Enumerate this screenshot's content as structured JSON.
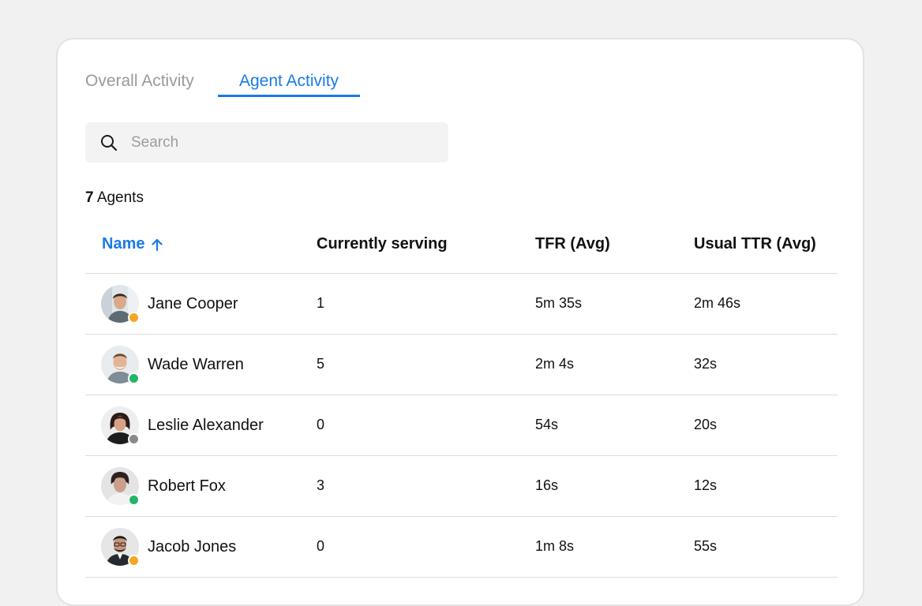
{
  "tabs": [
    {
      "label": "Overall Activity",
      "active": false
    },
    {
      "label": "Agent Activity",
      "active": true
    }
  ],
  "search": {
    "placeholder": "Search",
    "icon": "search-icon"
  },
  "agents_count": {
    "number": "7",
    "label": "Agents"
  },
  "table": {
    "headers": {
      "name": "Name",
      "sort_icon": "arrow-up-icon",
      "currently_serving": "Currently serving",
      "tfr": "TFR (Avg)",
      "ttr": "Usual TTR (Avg)"
    },
    "rows": [
      {
        "name": "Jane Cooper",
        "serving": "1",
        "tfr": "5m 35s",
        "ttr": "2m 46s",
        "status": "away",
        "status_color": "#f5a623"
      },
      {
        "name": "Wade Warren",
        "serving": "5",
        "tfr": "2m 4s",
        "ttr": "32s",
        "status": "online",
        "status_color": "#22b566"
      },
      {
        "name": "Leslie Alexander",
        "serving": "0",
        "tfr": "54s",
        "ttr": "20s",
        "status": "offline",
        "status_color": "#8a8a8a"
      },
      {
        "name": "Robert Fox",
        "serving": "3",
        "tfr": "16s",
        "ttr": "12s",
        "status": "online",
        "status_color": "#22b566"
      },
      {
        "name": "Jacob Jones",
        "serving": "0",
        "tfr": "1m 8s",
        "ttr": "55s",
        "status": "away",
        "status_color": "#f5a623"
      }
    ]
  },
  "colors": {
    "accent": "#1a7ae6",
    "online": "#22b566",
    "away": "#f5a623",
    "offline": "#8a8a8a"
  }
}
